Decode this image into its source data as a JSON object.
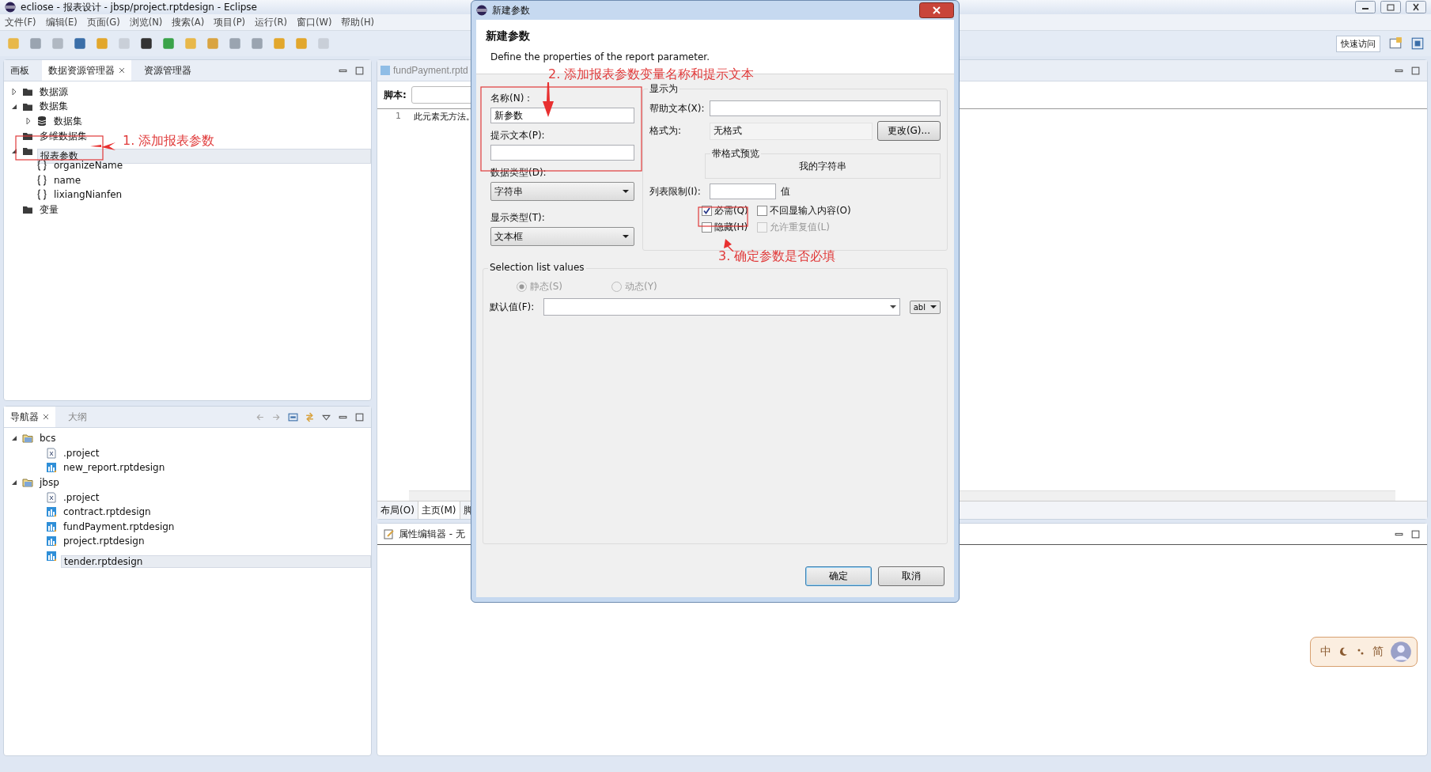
{
  "window": {
    "title": "ecliose - 报表设计 - jbsp/project.rptdesign - Eclipse"
  },
  "menu": [
    "文件(F)",
    "编辑(E)",
    "页面(G)",
    "浏览(N)",
    "搜索(A)",
    "项目(P)",
    "运行(R)",
    "窗口(W)",
    "帮助(H)"
  ],
  "toolbar": {
    "quick_access": "快速访问"
  },
  "data_explorer": {
    "tabs": [
      {
        "label": "画板",
        "selected": false,
        "closable": false
      },
      {
        "label": "数据资源管理器",
        "selected": true,
        "closable": true
      },
      {
        "label": "资源管理器",
        "selected": false,
        "closable": false
      }
    ],
    "tree": [
      {
        "label": "数据源",
        "kind": "folder",
        "expandable": true,
        "expanded": false,
        "selected": false
      },
      {
        "label": "数据集",
        "kind": "folder",
        "expandable": true,
        "expanded": true,
        "selected": false,
        "children": [
          {
            "label": "数据集",
            "kind": "dataset",
            "expandable": true,
            "expanded": false,
            "selected": false
          }
        ]
      },
      {
        "label": "多维数据集",
        "kind": "folder",
        "expandable": false,
        "selected": false
      },
      {
        "label": "报表参数",
        "kind": "folder",
        "expandable": true,
        "expanded": true,
        "selected": true,
        "children": [
          {
            "label": "organizeName",
            "kind": "parameter",
            "expandable": false,
            "selected": false
          },
          {
            "label": "name",
            "kind": "parameter",
            "expandable": false,
            "selected": false
          },
          {
            "label": "lixiangNianfen",
            "kind": "parameter",
            "expandable": false,
            "selected": false
          }
        ]
      },
      {
        "label": "变量",
        "kind": "folder",
        "expandable": false,
        "selected": false
      }
    ]
  },
  "navigator": {
    "tabs": [
      {
        "label": "导航器",
        "selected": true,
        "closable": true
      },
      {
        "label": "大纲",
        "selected": false,
        "closable": false
      }
    ],
    "tree": [
      {
        "label": "bcs",
        "kind": "project",
        "expandable": true,
        "expanded": true,
        "selected": false,
        "children": [
          {
            "label": ".project",
            "kind": "xml",
            "expandable": false,
            "selected": false
          },
          {
            "label": "new_report.rptdesign",
            "kind": "report",
            "expandable": false,
            "selected": false
          }
        ]
      },
      {
        "label": "jbsp",
        "kind": "project",
        "expandable": true,
        "expanded": true,
        "selected": false,
        "children": [
          {
            "label": ".project",
            "kind": "xml",
            "expandable": false,
            "selected": false
          },
          {
            "label": "contract.rptdesign",
            "kind": "report",
            "expandable": false,
            "selected": false
          },
          {
            "label": "fundPayment.rptdesign",
            "kind": "report",
            "expandable": false,
            "selected": false
          },
          {
            "label": "project.rptdesign",
            "kind": "report",
            "expandable": false,
            "selected": false
          },
          {
            "label": "tender.rptdesign",
            "kind": "report",
            "expandable": false,
            "selected": true
          }
        ]
      }
    ]
  },
  "editor": {
    "tab": "fundPayment.rptd",
    "script_label": "脚本:",
    "lines": [
      {
        "number": "1",
        "text": "此元素无方法。"
      }
    ],
    "bottom_tabs": [
      {
        "label": "布局(O)",
        "selected": false
      },
      {
        "label": "主页(M)",
        "selected": true
      },
      {
        "label": "脚",
        "selected": false
      }
    ]
  },
  "properties": {
    "title": "属性编辑器 - 无"
  },
  "dialog": {
    "title": "新建参数",
    "heading": "新建参数",
    "description": "Define the properties of the report parameter.",
    "name": {
      "label": "名称(N)：",
      "value": "新参数"
    },
    "prompt": {
      "label": "提示文本(P):"
    },
    "data_type": {
      "label": "数据类型(D):",
      "value": "字符串"
    },
    "display_type": {
      "label": "显示类型(T):",
      "value": "文本框"
    },
    "display_as": {
      "title": "显示为",
      "help_label": "帮助文本(X):",
      "format_label": "格式为:",
      "format_value": "无格式",
      "change_button": "更改(G)...",
      "preview_title": "带格式预览",
      "preview_text": "我的字符串",
      "limit_label": "列表限制(I):",
      "limit_unit": "值",
      "options": [
        {
          "label": "必需(Q)",
          "checked": true,
          "disabled": false
        },
        {
          "label": "不回显输入内容(O)",
          "checked": false,
          "disabled": false
        },
        {
          "label": "隐藏(H)",
          "checked": false,
          "disabled": false
        },
        {
          "label": "允许重复值(L)",
          "checked": false,
          "disabled": true
        }
      ]
    },
    "selection": {
      "title": "Selection list values",
      "radios": [
        {
          "label": "静态(S)",
          "selected": true,
          "disabled": true
        },
        {
          "label": "动态(Y)",
          "selected": false,
          "disabled": true
        }
      ],
      "default_label": "默认值(F):",
      "type_button": "abl"
    },
    "buttons": [
      {
        "label": "确定",
        "default": true
      },
      {
        "label": "取消",
        "default": false
      }
    ]
  },
  "ime": {
    "items": [
      "中",
      "简"
    ]
  },
  "annotations": [
    {
      "text": "1. 添加报表参数"
    },
    {
      "text": "2. 添加报表参数变量名称和提示文本"
    },
    {
      "text": "3. 确定参数是否必填"
    }
  ]
}
